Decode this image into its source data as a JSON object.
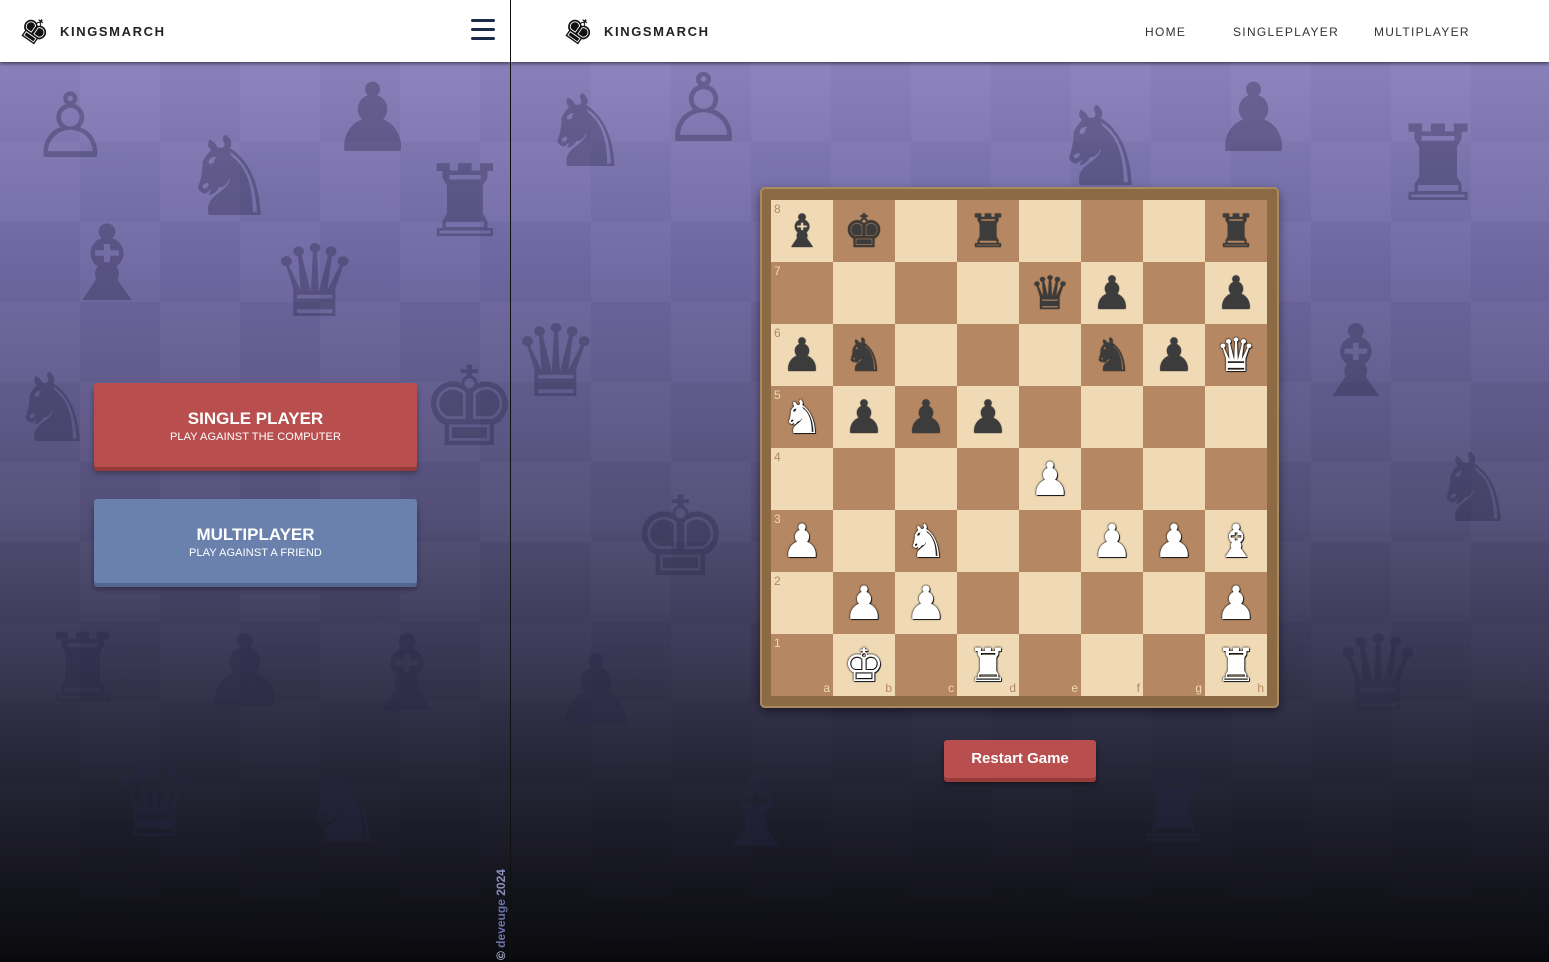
{
  "brand": {
    "name": "KINGSMARCH",
    "logo_icon": "chess-king-icon"
  },
  "left": {
    "menu_icon": "hamburger-menu-icon",
    "single_player": {
      "title": "SINGLE PLAYER",
      "subtitle": "PLAY AGAINST THE COMPUTER"
    },
    "multiplayer": {
      "title": "MULTIPLAYER",
      "subtitle": "PLAY AGAINST A FRIEND"
    },
    "copyright": {
      "symbol": "©",
      "author": "deveuge",
      "year": "2024"
    }
  },
  "right": {
    "nav": {
      "home": "HOME",
      "singleplayer": "SINGLEPLAYER",
      "multiplayer": "MULTIPLAYER"
    },
    "restart_label": "Restart Game"
  },
  "board": {
    "files": [
      "a",
      "b",
      "c",
      "d",
      "e",
      "f",
      "g",
      "h"
    ],
    "ranks": [
      "8",
      "7",
      "6",
      "5",
      "4",
      "3",
      "2",
      "1"
    ],
    "position": [
      [
        "bB",
        "bK",
        "",
        "bR",
        "",
        "",
        "",
        "bR"
      ],
      [
        "",
        "",
        "",
        "",
        "bQ",
        "bP",
        "",
        "bP"
      ],
      [
        "bP",
        "bN",
        "",
        "",
        "",
        "bN",
        "bP",
        "wQ"
      ],
      [
        "wN",
        "bP",
        "bP",
        "bP",
        "",
        "",
        "",
        ""
      ],
      [
        "",
        "",
        "",
        "",
        "wP",
        "",
        "",
        ""
      ],
      [
        "wP",
        "",
        "wN",
        "",
        "",
        "wP",
        "wP",
        "wB"
      ],
      [
        "",
        "wP",
        "wP",
        "",
        "",
        "",
        "",
        "wP"
      ],
      [
        "",
        "wK",
        "",
        "wR",
        "",
        "",
        "",
        "wR"
      ]
    ]
  },
  "colors": {
    "light_square": "#f0d9b5",
    "dark_square": "#b58863",
    "single_button": "#b84e4d",
    "multi_button": "#6a80ad",
    "restart_button": "#b84e4d"
  }
}
